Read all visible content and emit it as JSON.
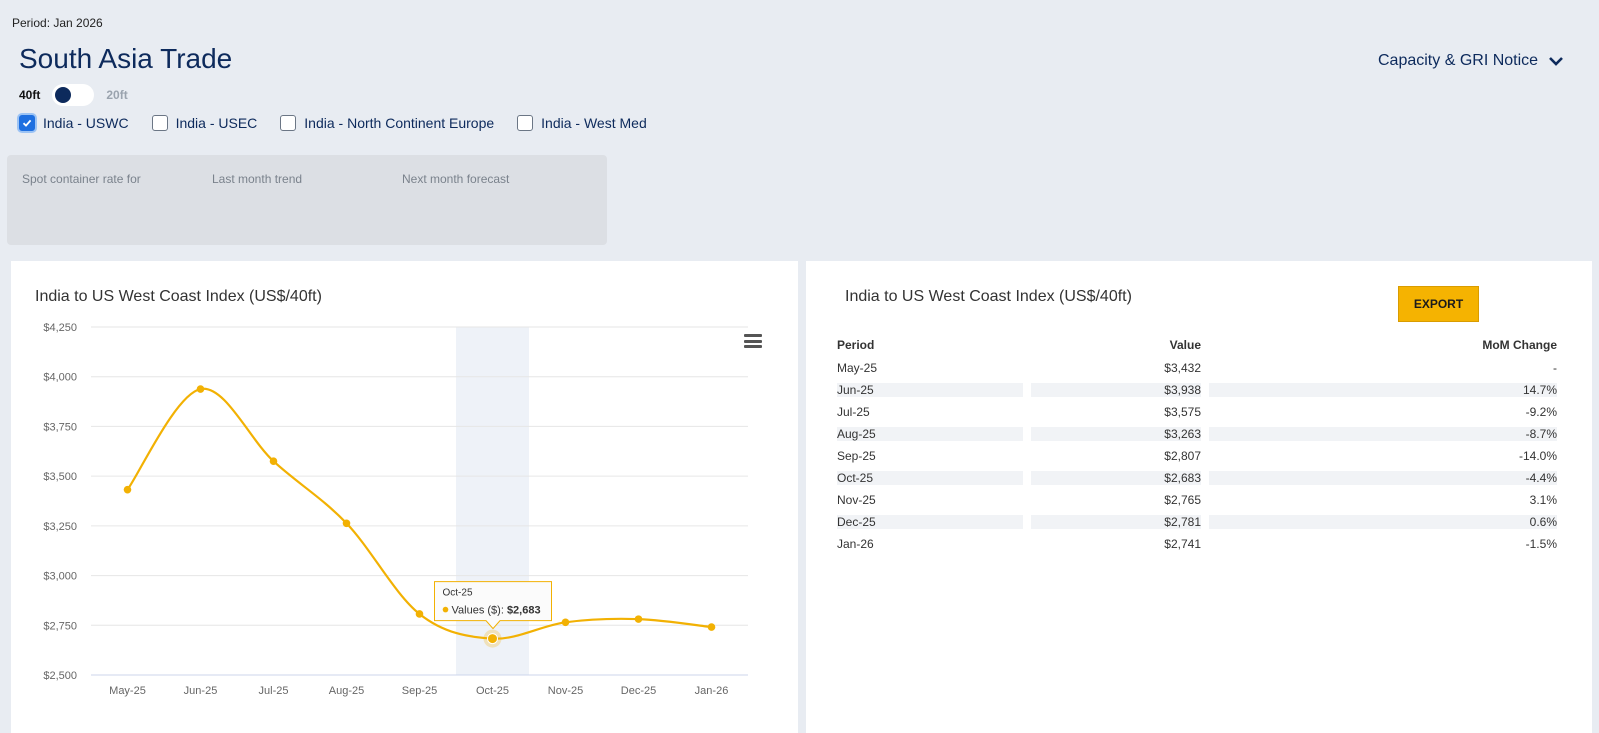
{
  "header": {
    "period": "Period: Jan 2026",
    "title": "South Asia Trade",
    "notice_label": "Capacity & GRI Notice"
  },
  "size_toggle": {
    "left_label": "40ft",
    "right_label": "20ft",
    "selected": "40ft"
  },
  "routes": [
    {
      "label": "India - USWC",
      "checked": true
    },
    {
      "label": "India - USEC",
      "checked": false
    },
    {
      "label": "India - North Continent Europe",
      "checked": false
    },
    {
      "label": "India - West Med",
      "checked": false
    }
  ],
  "summary": {
    "spot_label": "Spot container rate for",
    "trend_label": "Last month trend",
    "forecast_label": "Next month forecast"
  },
  "chart_panel": {
    "title": "India to US West Coast Index (US$/40ft)"
  },
  "chart_data": {
    "type": "line",
    "title": "India to US West Coast Index (US$/40ft)",
    "categories": [
      "May-25",
      "Jun-25",
      "Jul-25",
      "Aug-25",
      "Sep-25",
      "Oct-25",
      "Nov-25",
      "Dec-25",
      "Jan-26"
    ],
    "series": [
      {
        "name": "Values ($)",
        "values": [
          3432,
          3938,
          3575,
          3263,
          2807,
          2683,
          2765,
          2781,
          2741
        ],
        "color": "#f2b103"
      }
    ],
    "y_ticks": [
      "$2,500",
      "$2,750",
      "$3,000",
      "$3,250",
      "$3,500",
      "$3,750",
      "$4,000",
      "$4,250"
    ],
    "ylim": [
      2500,
      4250
    ],
    "grid": true,
    "highlighted_category": "Oct-25",
    "tooltip": {
      "category": "Oct-25",
      "label": "Values ($): ",
      "value": "$2,683"
    }
  },
  "table_panel": {
    "title": "India to US West Coast Index (US$/40ft)",
    "export_label": "EXPORT",
    "columns": [
      "Period",
      "Value",
      "MoM Change"
    ],
    "rows": [
      [
        "May-25",
        "$3,432",
        "-"
      ],
      [
        "Jun-25",
        "$3,938",
        "14.7%"
      ],
      [
        "Jul-25",
        "$3,575",
        "-9.2%"
      ],
      [
        "Aug-25",
        "$3,263",
        "-8.7%"
      ],
      [
        "Sep-25",
        "$2,807",
        "-14.0%"
      ],
      [
        "Oct-25",
        "$2,683",
        "-4.4%"
      ],
      [
        "Nov-25",
        "$2,765",
        "3.1%"
      ],
      [
        "Dec-25",
        "$2,781",
        "0.6%"
      ],
      [
        "Jan-26",
        "$2,741",
        "-1.5%"
      ]
    ]
  },
  "colors": {
    "accent": "#f2b103",
    "brand_navy": "#0d2a5c",
    "checkbox_blue": "#1e6fe0"
  }
}
